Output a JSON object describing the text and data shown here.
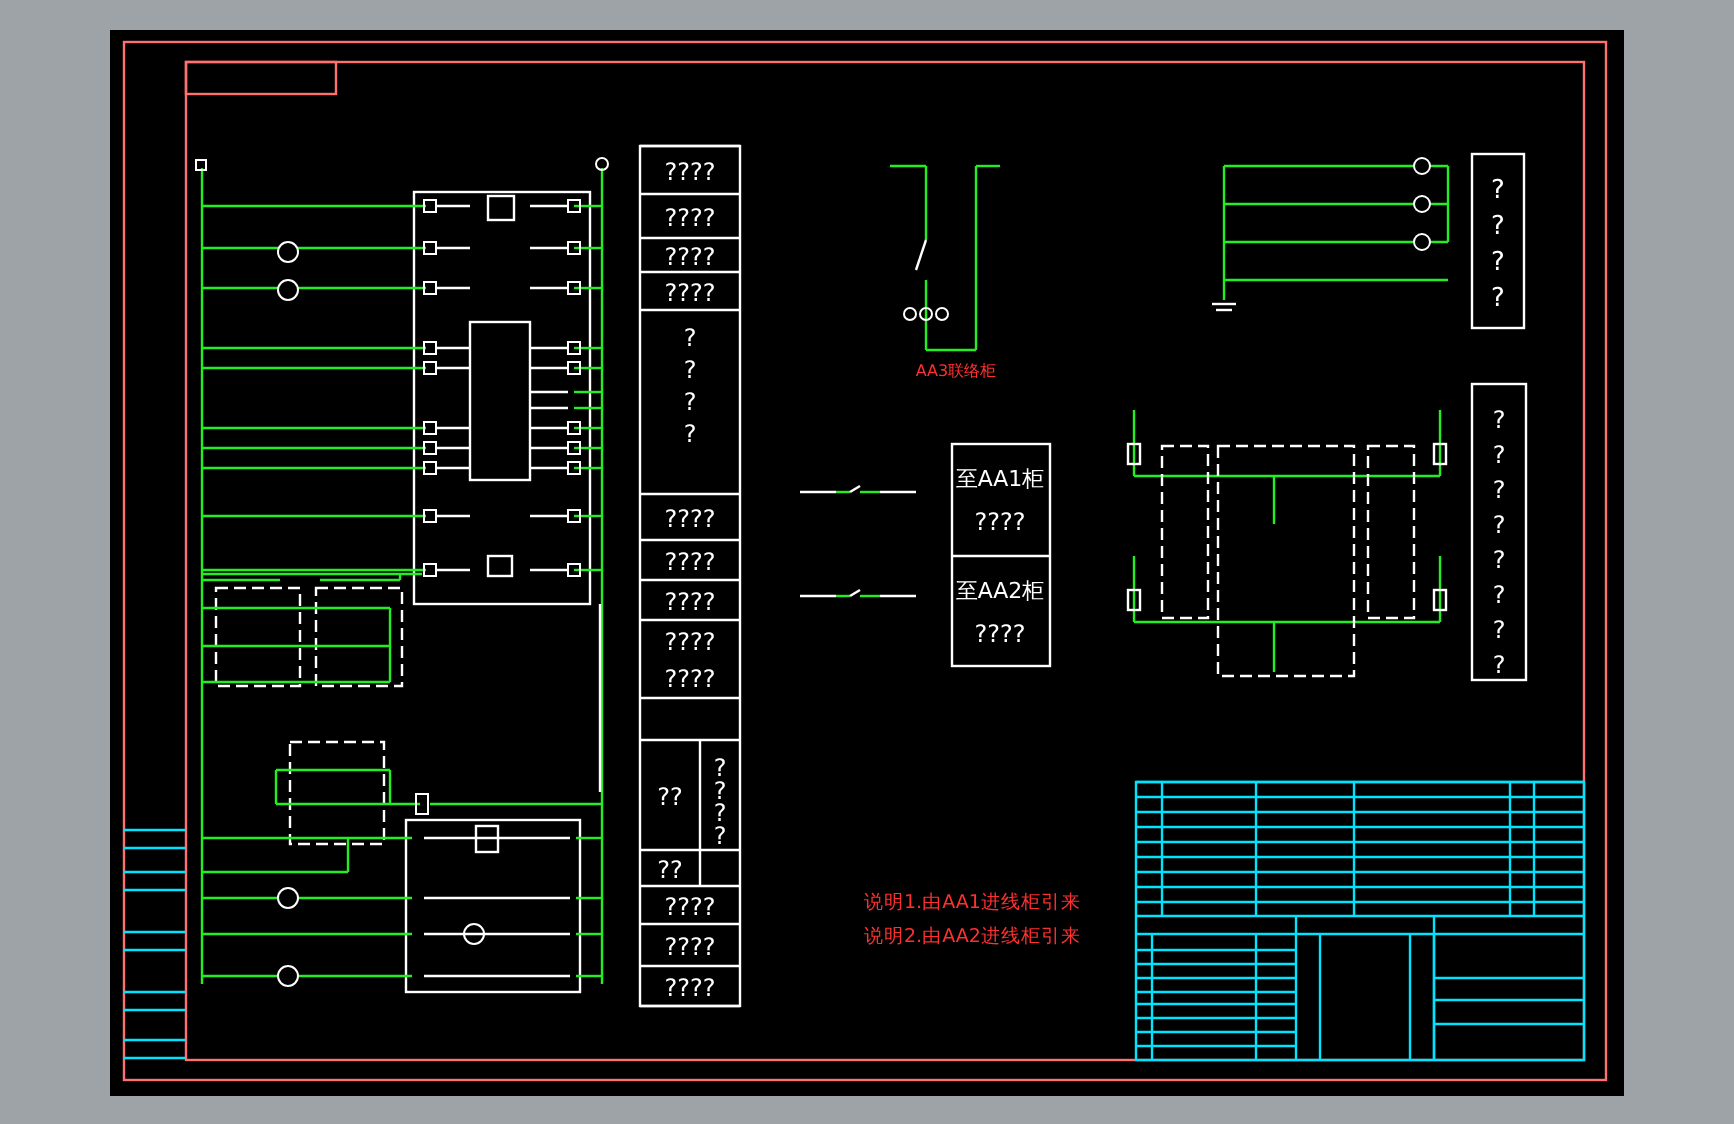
{
  "function_column": [
    {
      "text": "????",
      "kind": "horizontal"
    },
    {
      "text": "????",
      "kind": "horizontal"
    },
    {
      "text": "????",
      "kind": "horizontal"
    },
    {
      "text": "????",
      "kind": "horizontal"
    },
    {
      "text": "????",
      "kind": "vertical"
    },
    {
      "text": "????",
      "kind": "horizontal"
    },
    {
      "text": "????",
      "kind": "horizontal"
    },
    {
      "text": "????",
      "kind": "horizontal"
    },
    {
      "text": "????",
      "kind": "horizontal"
    },
    {
      "text": "????",
      "kind": "horizontal"
    },
    {
      "text": "??",
      "kind": "horizontal"
    },
    {
      "text": "????",
      "kind": "vertical"
    },
    {
      "text": "??",
      "kind": "horizontal"
    },
    {
      "text": "????",
      "kind": "horizontal"
    },
    {
      "text": "????",
      "kind": "horizontal"
    },
    {
      "text": "????",
      "kind": "horizontal"
    }
  ],
  "tie_panel_label": "AA3联络柜",
  "destination_table": [
    {
      "title": "至AA1柜",
      "text": "????"
    },
    {
      "title": "至AA2柜",
      "text": "????"
    }
  ],
  "meter_legend": "????",
  "interlock_legend": "????????",
  "notes": [
    "说明1.由AA1进线柜引来",
    "说明2.由AA2进线柜引来"
  ]
}
